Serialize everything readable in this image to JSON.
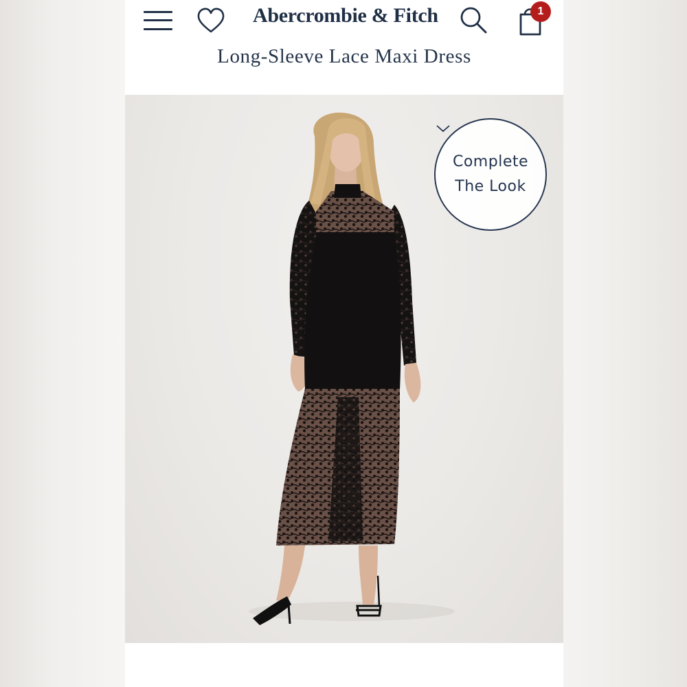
{
  "header": {
    "brand": "Abercrombie & Fitch",
    "product_title": "Long-Sleeve Lace Maxi Dress",
    "bag_count": "1",
    "icons": {
      "menu": "hamburger-menu-icon",
      "wishlist": "heart-icon",
      "search": "search-icon",
      "bag": "shopping-bag-icon"
    }
  },
  "gallery": {
    "complete_the_look": {
      "line1": "Complete",
      "line2": "The Look",
      "icon": "chevron-down-icon"
    }
  },
  "colors": {
    "brand_navy": "#1f2f45",
    "badge_red": "#b51d1d",
    "photo_bg": "#ebe9e6",
    "dress": "#121010"
  }
}
